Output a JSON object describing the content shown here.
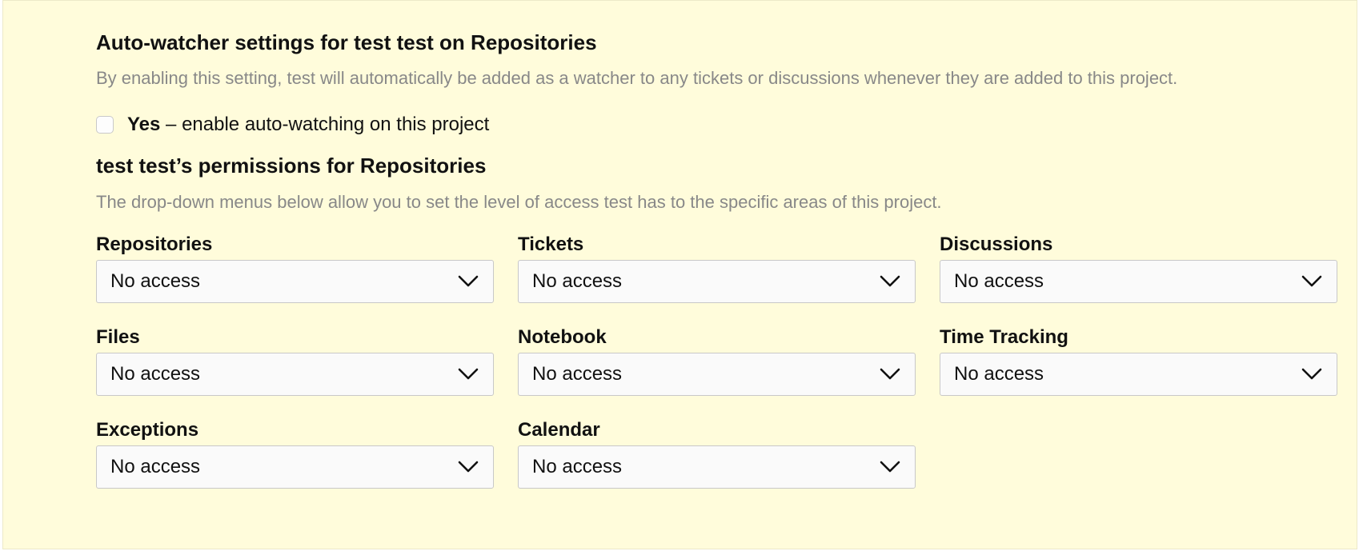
{
  "watcher": {
    "title": "Auto-watcher settings for test test on Repositories",
    "description": "By enabling this setting, test will automatically be added as a watcher to any tickets or discussions whenever they are added to this project.",
    "checkbox_bold": "Yes",
    "checkbox_rest": " – enable auto-watching on this project",
    "checked": false
  },
  "permissions": {
    "title": "test test’s permissions for Repositories",
    "description": "The drop-down menus below allow you to set the level of access test has to the specific areas of this project.",
    "fields": [
      {
        "label": "Repositories",
        "value": "No access"
      },
      {
        "label": "Tickets",
        "value": "No access"
      },
      {
        "label": "Discussions",
        "value": "No access"
      },
      {
        "label": "Files",
        "value": "No access"
      },
      {
        "label": "Notebook",
        "value": "No access"
      },
      {
        "label": "Time Tracking",
        "value": "No access"
      },
      {
        "label": "Exceptions",
        "value": "No access"
      },
      {
        "label": "Calendar",
        "value": "No access"
      }
    ]
  },
  "icons": {
    "dropdown": "chevron-down-icon"
  },
  "colors": {
    "panel_background": "#fffcdb",
    "description_text": "#888888",
    "heading_text": "#111111"
  }
}
